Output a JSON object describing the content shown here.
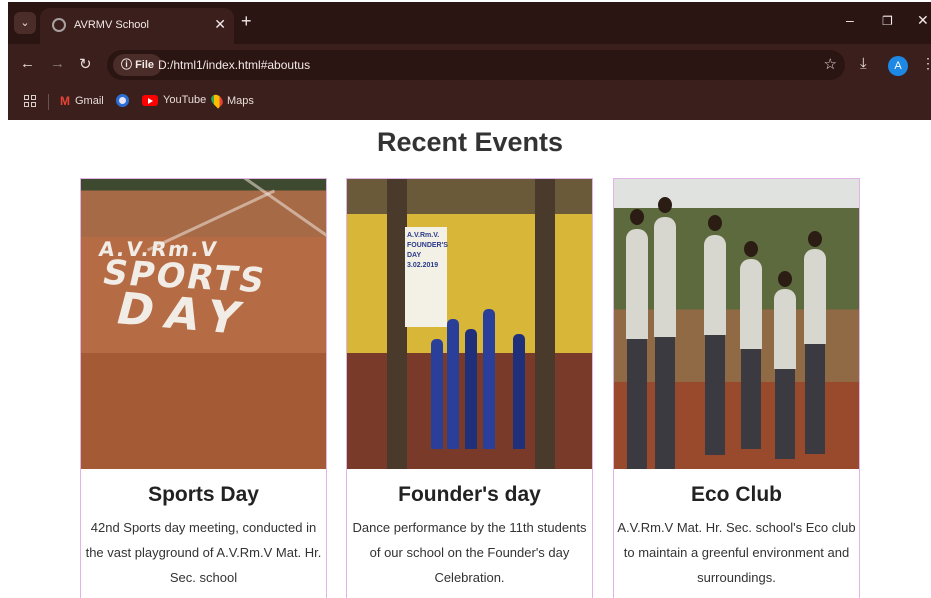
{
  "browser": {
    "tab_title": "AVRMV School",
    "url_chip": "File",
    "url": "D:/html1/index.html#aboutus",
    "avatar_initial": "A",
    "bookmarks": [
      "Gmail",
      "YouTube",
      "Maps"
    ]
  },
  "page": {
    "section_title": "Recent Events",
    "cards": [
      {
        "title": "Sports Day",
        "description": "42nd Sports day meeting, conducted in the vast playground of A.V.Rm.V Mat. Hr. Sec. school",
        "photo_text": [
          "A.V.Rm.V",
          "SPORTS",
          "DAY"
        ]
      },
      {
        "title": "Founder's day",
        "description": "Dance performance by the 11th students of our school on the Founder's day Celebration.",
        "photo_text": [
          "A.V.Rm.V.",
          "FOUNDER'S DAY",
          "3.02.2019"
        ]
      },
      {
        "title": "Eco Club",
        "description": "A.V.Rm.V Mat. Hr. Sec. school's Eco club to maintain a greenful environment and surroundings."
      }
    ]
  },
  "colors": {
    "chrome_dark": "#2b1512",
    "chrome": "#3a1f1c",
    "card_border": "#e1b4e6",
    "avatar": "#1e88e5"
  }
}
